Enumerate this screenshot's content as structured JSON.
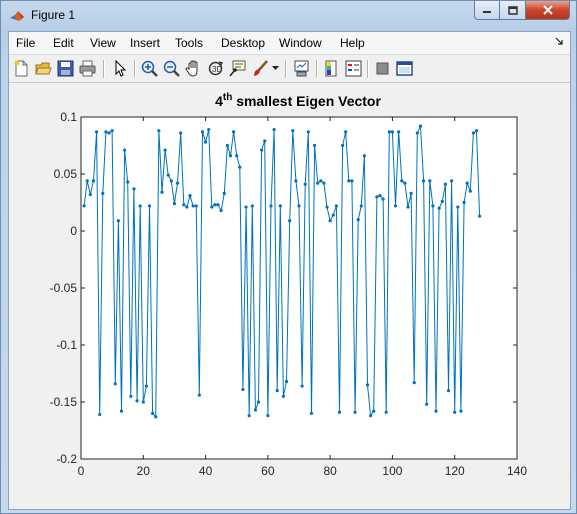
{
  "window": {
    "title": "Figure 1"
  },
  "menu": {
    "items": [
      {
        "label": "File"
      },
      {
        "label": "Edit"
      },
      {
        "label": "View"
      },
      {
        "label": "Insert"
      },
      {
        "label": "Tools"
      },
      {
        "label": "Desktop"
      },
      {
        "label": "Window"
      },
      {
        "label": "Help"
      }
    ]
  },
  "toolbar": {
    "buttons": [
      "new-figure-icon",
      "open-file-icon",
      "save-icon",
      "print-icon",
      "pointer-icon",
      "zoom-in-icon",
      "zoom-out-icon",
      "pan-icon",
      "rotate-3d-icon",
      "data-cursor-icon",
      "brush-icon",
      "link-plot-icon",
      "colorbar-icon",
      "legend-icon",
      "hide-plot-tools-icon",
      "show-plot-tools-icon"
    ]
  },
  "chart_data": {
    "type": "line",
    "title_main": "4",
    "title_sup": "th",
    "title_rest": " smallest Eigen Vector",
    "xlim": [
      0,
      140
    ],
    "ylim": [
      -0.2,
      0.1
    ],
    "xticks": [
      0,
      20,
      40,
      60,
      80,
      100,
      120,
      140
    ],
    "yticks": [
      -0.2,
      -0.15,
      -0.1,
      -0.05,
      0,
      0.05,
      0.1
    ],
    "ytick_labels": [
      "-0.2",
      "-0.15",
      "-0.1",
      "-0.05",
      "0",
      "0.05",
      "0.1"
    ],
    "xtick_labels": [
      "0",
      "20",
      "40",
      "60",
      "80",
      "100",
      "120",
      "140"
    ],
    "color": "#0072bd",
    "series": [
      {
        "x": [
          1,
          2,
          3,
          4,
          5,
          6,
          7,
          8,
          9,
          10,
          11,
          12,
          13,
          14,
          15,
          16,
          17,
          18,
          19,
          20,
          21,
          22,
          23,
          24,
          25,
          26,
          27,
          28,
          29,
          30,
          31,
          32,
          33,
          34,
          35,
          36,
          37,
          38,
          39,
          40,
          41,
          42,
          43,
          44,
          45,
          46,
          47,
          48,
          49,
          50,
          51,
          52,
          53,
          54,
          55,
          56,
          57,
          58,
          59,
          60,
          61,
          62,
          63,
          64,
          65,
          66,
          67,
          68,
          69,
          70,
          71,
          72,
          73,
          74,
          75,
          76,
          77,
          78,
          79,
          80,
          81,
          82,
          83,
          84,
          85,
          86,
          87,
          88,
          89,
          90,
          91,
          92,
          93,
          94,
          95,
          96,
          97,
          98,
          99,
          100,
          101,
          102,
          103,
          104,
          105,
          106,
          107,
          108,
          109,
          110,
          111,
          112,
          113,
          114,
          115,
          116,
          117,
          118,
          119,
          120,
          121,
          122,
          123,
          124,
          125,
          126,
          127,
          128
        ],
        "y": [
          0.022,
          0.044,
          0.032,
          0.044,
          0.087,
          -0.161,
          0.033,
          0.087,
          0.086,
          0.088,
          -0.134,
          0.009,
          -0.158,
          0.071,
          0.043,
          -0.145,
          0.037,
          -0.149,
          0.022,
          -0.15,
          -0.136,
          0.022,
          -0.16,
          -0.163,
          0.088,
          0.034,
          0.071,
          0.049,
          0.044,
          0.024,
          0.042,
          0.086,
          0.023,
          0.021,
          0.031,
          0.022,
          0.022,
          -0.144,
          0.087,
          0.078,
          0.089,
          0.021,
          0.023,
          0.023,
          0.018,
          0.033,
          0.075,
          0.066,
          0.087,
          0.066,
          0.056,
          -0.139,
          0.021,
          -0.162,
          0.022,
          -0.157,
          -0.15,
          0.071,
          0.079,
          -0.162,
          0.022,
          0.089,
          -0.14,
          0.022,
          -0.145,
          -0.132,
          0.009,
          0.088,
          0.044,
          0.022,
          -0.136,
          0.041,
          0.087,
          -0.16,
          0.075,
          0.042,
          0.044,
          0.042,
          0.021,
          0.009,
          0.014,
          0.022,
          -0.159,
          0.075,
          0.087,
          0.044,
          0.044,
          -0.159,
          0.01,
          0.022,
          0.066,
          -0.135,
          -0.162,
          -0.158,
          0.03,
          0.031,
          0.028,
          -0.159,
          0.087,
          0.087,
          0.022,
          0.087,
          0.044,
          0.042,
          0.021,
          0.033,
          -0.133,
          0.086,
          0.092,
          0.044,
          -0.152,
          0.044,
          0.022,
          -0.158,
          0.02,
          0.026,
          0.041,
          -0.14,
          0.044,
          -0.159,
          0.021,
          -0.158,
          0.025,
          0.042,
          0.035,
          0.086,
          0.088,
          0.013
        ]
      }
    ]
  }
}
